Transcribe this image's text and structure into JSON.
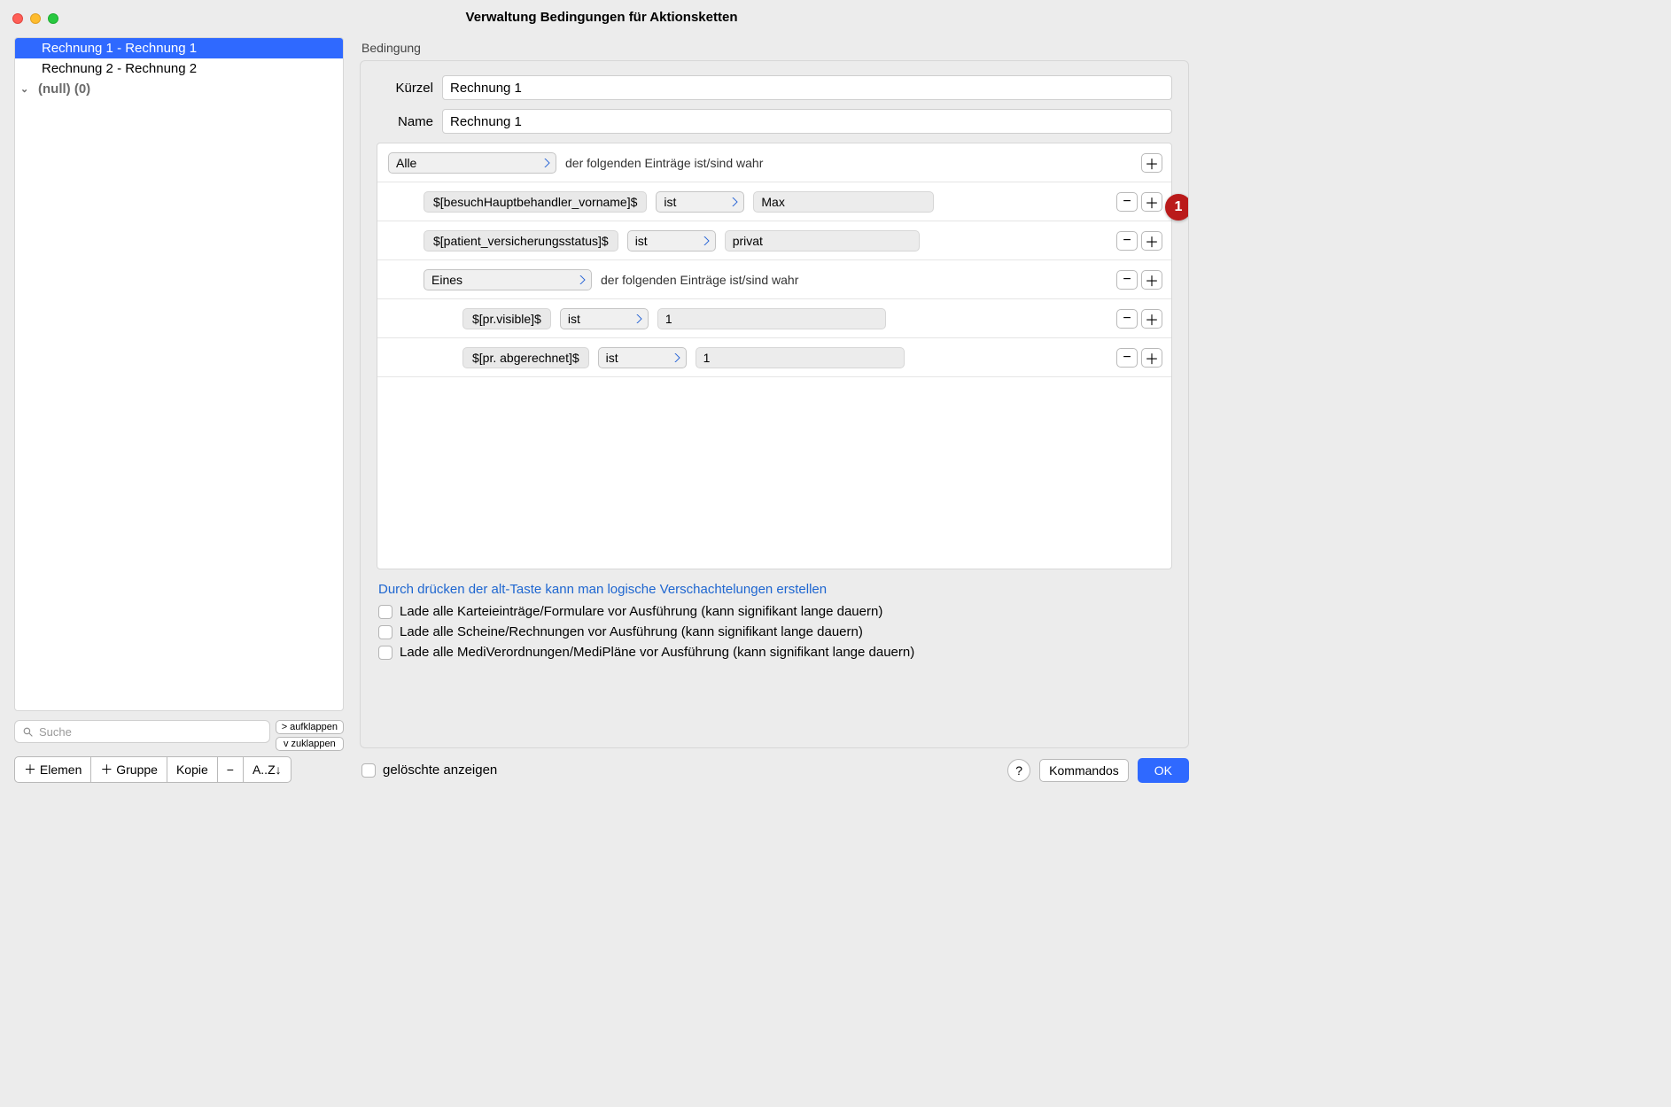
{
  "window": {
    "title": "Verwaltung Bedingungen für Aktionsketten"
  },
  "sidebar": {
    "items": [
      {
        "label": "Rechnung 1 - Rechnung 1",
        "selected": true,
        "group": false
      },
      {
        "label": "Rechnung 2 - Rechnung 2",
        "selected": false,
        "group": false
      },
      {
        "label": "(null) (0)",
        "selected": false,
        "group": true
      }
    ],
    "search_placeholder": "Suche",
    "expand_label": "> aufklappen",
    "collapse_label": "v  zuklappen",
    "toolbar": {
      "add_element": "＋ Elemen",
      "add_group": "＋ Gruppe",
      "copy": "Kopie",
      "remove": "−",
      "sort": "A..Z↓"
    }
  },
  "editor": {
    "section_label": "Bedingung",
    "kuerzel_label": "Kürzel",
    "kuerzel_value": "Rechnung 1",
    "name_label": "Name",
    "name_value": "Rechnung 1",
    "rows": [
      {
        "indent": 0,
        "type": "group",
        "selector": "Alle",
        "text": "der folgenden Einträge ist/sind wahr",
        "has_minus": false
      },
      {
        "indent": 1,
        "type": "leaf",
        "field": "$[besuchHauptbehandler_vorname]$",
        "op": "ist",
        "value": "Max",
        "has_minus": true
      },
      {
        "indent": 1,
        "type": "leaf",
        "field": "$[patient_versicherungsstatus]$",
        "op": "ist",
        "value": "privat",
        "has_minus": true
      },
      {
        "indent": 1,
        "type": "group",
        "selector": "Eines",
        "text": "der folgenden Einträge ist/sind wahr",
        "has_minus": true
      },
      {
        "indent": 2,
        "type": "leaf",
        "field": "$[pr.visible]$",
        "op": "ist",
        "value": "1",
        "has_minus": true
      },
      {
        "indent": 2,
        "type": "leaf",
        "field": "$[pr. abgerechnet]$",
        "op": "ist",
        "value": "1",
        "has_minus": true
      }
    ],
    "hint": "Durch drücken der alt-Taste kann man logische Verschachtelungen erstellen",
    "checks": [
      "Lade alle Karteieinträge/Formulare vor Ausführung (kann signifikant lange dauern)",
      "Lade alle Scheine/Rechnungen vor Ausführung (kann signifikant lange dauern)",
      "Lade alle MediVerordnungen/MediPläne vor Ausführung (kann signifikant lange dauern)"
    ]
  },
  "footer": {
    "show_deleted": "gelöschte anzeigen",
    "help": "?",
    "kommandos": "Kommandos",
    "ok": "OK"
  },
  "badge": "1"
}
